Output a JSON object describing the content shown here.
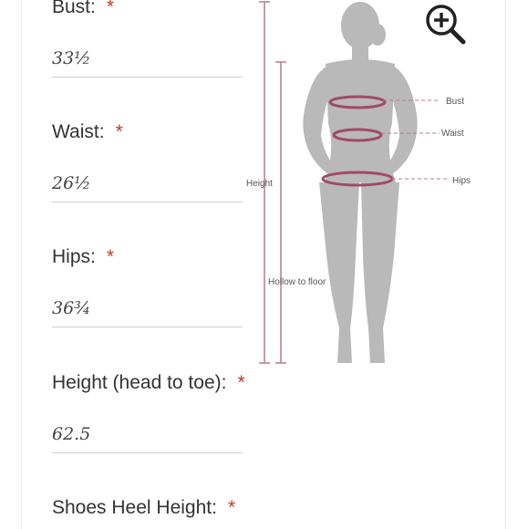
{
  "form": {
    "fields": [
      {
        "id": "bust",
        "label": "Bust:",
        "required_mark": "*",
        "value": "33½"
      },
      {
        "id": "waist",
        "label": "Waist:",
        "required_mark": "*",
        "value": "26½"
      },
      {
        "id": "hips",
        "label": "Hips:",
        "required_mark": "*",
        "value": "36¾"
      },
      {
        "id": "height",
        "label": "Height (head to toe):",
        "required_mark": "*",
        "value": "62.5"
      },
      {
        "id": "heel",
        "label": "Shoes Heel Height:",
        "required_mark": "*",
        "value": ""
      }
    ]
  },
  "size_chart": {
    "labels": {
      "bust": "Bust",
      "waist": "Waist",
      "hips": "Hips",
      "height": "Height",
      "hollow": "Hollow to floor"
    },
    "zoom_icon": "zoom-in-icon"
  },
  "colors": {
    "required": "#c0392b",
    "figure": "#b9b9b9",
    "measure_line": "#b77b8e",
    "label_text": "#555555"
  }
}
